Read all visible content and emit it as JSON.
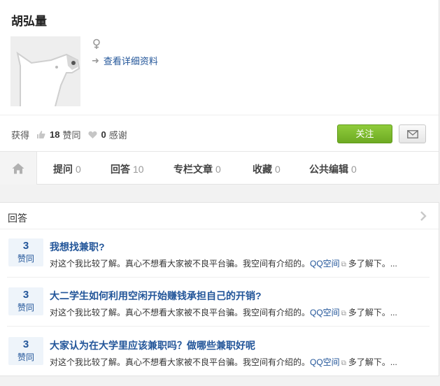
{
  "profile": {
    "name": "胡弘量",
    "gender_symbol": "♀",
    "detail_link": "查看详细资料"
  },
  "stats": {
    "obtained_label": "获得",
    "upvote_count": "18",
    "upvote_label": "赞同",
    "thanks_count": "0",
    "thanks_label": "感谢"
  },
  "actions": {
    "follow_label": "关注"
  },
  "tabs": [
    {
      "label": "提问",
      "count": "0"
    },
    {
      "label": "回答",
      "count": "10"
    },
    {
      "label": "专栏文章",
      "count": "0"
    },
    {
      "label": "收藏",
      "count": "0"
    },
    {
      "label": "公共编辑",
      "count": "0"
    }
  ],
  "answers_panel": {
    "title": "回答",
    "items": [
      {
        "votes": "3",
        "vote_label": "赞同",
        "title": "我想找兼职?",
        "summary_text": "对这个我比较了解。真心不想看大家被不良平台骗。我空间有介绍的。",
        "link": "QQ空间",
        "more": "多了解下。..."
      },
      {
        "votes": "3",
        "vote_label": "赞同",
        "title": "大二学生如何利用空闲开始赚钱承担自己的开销?",
        "summary_text": "对这个我比较了解。真心不想看大家被不良平台骗。我空间有介绍的。",
        "link": "QQ空间",
        "more": "多了解下。..."
      },
      {
        "votes": "3",
        "vote_label": "赞同",
        "title": "大家认为在大学里应该兼职吗？做哪些兼职好呢",
        "summary_text": "对这个我比较了解。真心不想看大家被不良平台骗。我空间有介绍的。",
        "link": "QQ空间",
        "more": "多了解下。..."
      }
    ]
  },
  "colors": {
    "link": "#225599",
    "follow_button": "#7ab62e",
    "vote_bg": "#eef4fa"
  },
  "icons": [
    "female-symbol-icon",
    "arrow-right-icon",
    "thumbs-up-icon",
    "heart-icon",
    "mail-icon",
    "home-icon",
    "chevron-right-icon",
    "external-link-icon"
  ]
}
